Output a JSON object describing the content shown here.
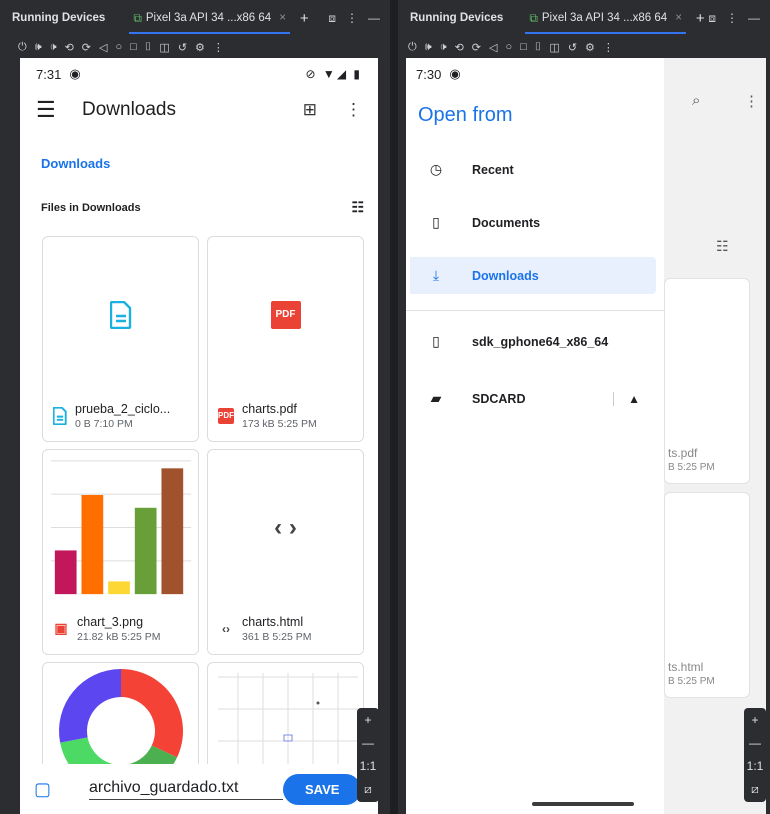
{
  "ide": {
    "title": "Running Devices",
    "tab_label": "Pixel 3a API 34 ...x86 64",
    "tab_close": "×",
    "add_tab": "+",
    "menu_dots": "⋮",
    "minimize": "—"
  },
  "left": {
    "status": {
      "time": "7:31"
    },
    "appbar": {
      "title": "Downloads"
    },
    "breadcrumb": "Downloads",
    "section_title": "Files in Downloads",
    "files": [
      {
        "name": "prueba_2_ciclo...",
        "meta": "0 B 7:10 PM",
        "icon": "document-icon"
      },
      {
        "name": "charts.pdf",
        "meta": "173 kB 5:25 PM",
        "icon": "pdf-icon",
        "badge": "PDF"
      },
      {
        "name": "chart_3.png",
        "meta": "21.82 kB 5:25 PM",
        "icon": "image-icon"
      },
      {
        "name": "charts.html",
        "meta": "361 B 5:25 PM",
        "icon": "code-icon"
      }
    ],
    "save": {
      "filename": "archivo_guardado.txt",
      "button": "SAVE"
    },
    "zoom": {
      "plus": "+",
      "minus": "—",
      "ratio": "1:1"
    }
  },
  "right": {
    "status": {
      "time": "7:30"
    },
    "drawer_title": "Open from",
    "roots": [
      {
        "label": "Recent",
        "icon": "clock-icon"
      },
      {
        "label": "Documents",
        "icon": "document-icon"
      },
      {
        "label": "Downloads",
        "icon": "download-icon",
        "active": true
      }
    ],
    "devices": [
      {
        "label": "sdk_gphone64_x86_64",
        "icon": "phone-icon"
      },
      {
        "label": "SDCARD",
        "icon": "sdcard-icon",
        "eject": "▲"
      }
    ],
    "background_files": [
      {
        "name": "ts.pdf",
        "meta": "B 5:25 PM"
      },
      {
        "name": "ts.html",
        "meta": "B 5:25 PM"
      }
    ],
    "zoom": {
      "plus": "+",
      "minus": "—",
      "ratio": "1:1"
    }
  },
  "chart_thumb": {
    "bar_values": [
      41,
      93,
      12,
      81,
      118
    ],
    "bar_colors": [
      "#c2185b",
      "#ff6f00",
      "#fdd835",
      "#689f38",
      "#a0522d"
    ]
  },
  "donut_thumb": {
    "slices": [
      {
        "value": 32,
        "color": "#f44336"
      },
      {
        "value": 18,
        "color": "#4caf50"
      },
      {
        "value": 22,
        "color": "#4cd964"
      },
      {
        "value": 28,
        "color": "#5b46f0"
      }
    ]
  }
}
